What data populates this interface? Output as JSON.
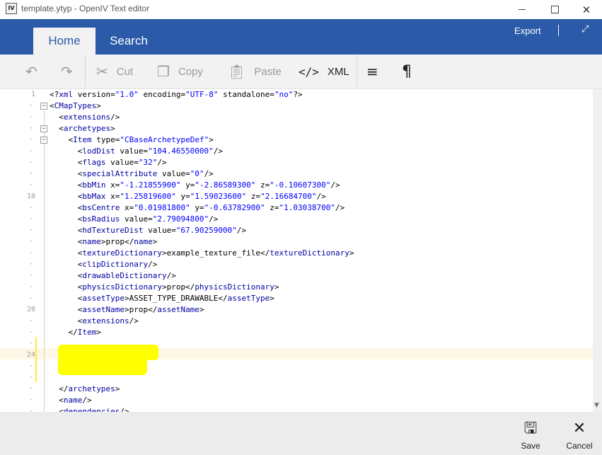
{
  "window": {
    "title": "template.ytyp - OpenIV Text editor",
    "app_icon_text": "IV",
    "minimize_icon": "minimize-icon",
    "maximize_icon": "maximize-icon",
    "close_icon": "close-icon"
  },
  "ribbon": {
    "tabs": [
      {
        "label": "Home",
        "active": true
      },
      {
        "label": "Search",
        "active": false
      }
    ],
    "export_label": "Export",
    "expand_glyph": "⤢",
    "accent_color": "#2a5aa8"
  },
  "toolbar": {
    "undo_icon": "↶",
    "redo_icon": "↷",
    "cut_label": "Cut",
    "copy_label": "Copy",
    "paste_label": "Paste",
    "xml_label": "XML",
    "xml_icon": "</>",
    "format_icon": "≡",
    "pilcrow_icon": "¶"
  },
  "editor": {
    "line_numbers": [
      {
        "n": "1",
        "row": 0
      },
      {
        "n": "10",
        "row": 9
      },
      {
        "n": "20",
        "row": 19
      },
      {
        "n": "24",
        "row": 23
      }
    ],
    "lines": [
      "<?xml version=\"1.0\" encoding=\"UTF-8\" standalone=\"no\"?>",
      "<CMapTypes>",
      "  <extensions/>",
      "  <archetypes>",
      "    <Item type=\"CBaseArchetypeDef\">",
      "      <lodDist value=\"104.46550000\"/>",
      "      <flags value=\"32\"/>",
      "      <specialAttribute value=\"0\"/>",
      "      <bbMin x=\"-1.21855900\" y=\"-2.86589300\" z=\"-0.10607300\"/>",
      "      <bbMax x=\"1.25819600\" y=\"1.59023600\" z=\"2.16684700\"/>",
      "      <bsCentre x=\"0.01981800\" y=\"-0.63782900\" z=\"1.03038700\"/>",
      "      <bsRadius value=\"2.79094800\"/>",
      "      <hdTextureDist value=\"67.90259000\"/>",
      "      <name>prop</name>",
      "      <textureDictionary>example_texture_file</textureDictionary>",
      "      <clipDictionary/>",
      "      <drawableDictionary/>",
      "      <physicsDictionary>prop</physicsDictionary>",
      "      <assetType>ASSET_TYPE_DRAWABLE</assetType>",
      "      <assetName>prop</assetName>",
      "      <extensions/>",
      "    </Item>",
      "",
      "",
      "",
      "",
      "  </archetypes>",
      "  <name/>",
      "  <dependencies/>"
    ]
  },
  "bottom": {
    "save_label": "Save",
    "cancel_label": "Cancel",
    "save_icon": "save-icon",
    "cancel_icon": "cancel-icon"
  }
}
